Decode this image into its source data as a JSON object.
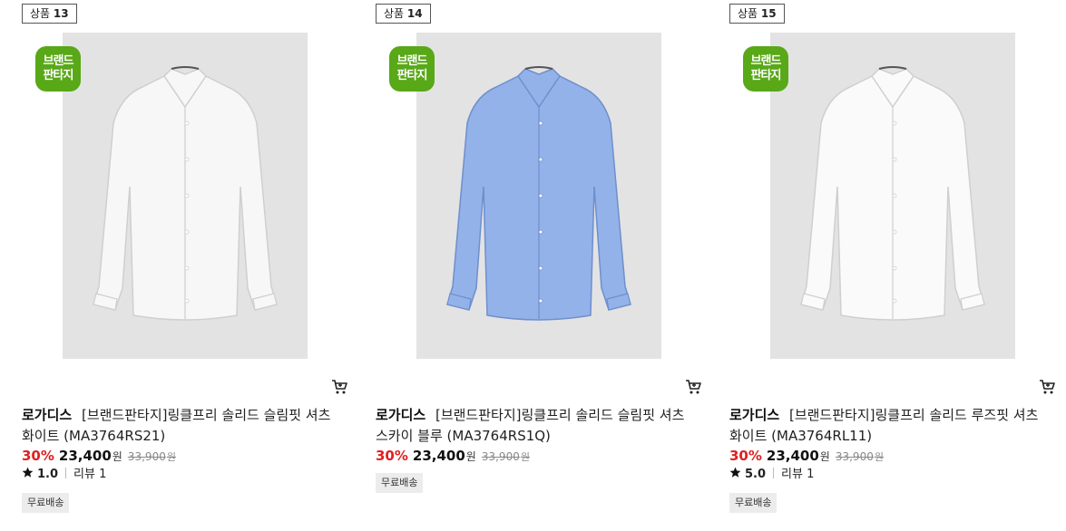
{
  "products": [
    {
      "tag_prefix": "상품",
      "tag_number": "13",
      "badge_line1": "브랜드",
      "badge_line2": "판타지",
      "brand": "로가디스",
      "name_line1": "[브랜드판타지]링클프리 솔리드 슬림핏 셔츠",
      "name_line2": "화이트 (MA3764RS21)",
      "discount": "30%",
      "price": "23,400",
      "currency": "원",
      "original_price": "33,900",
      "rating": "1.0",
      "review_label": "리뷰 1",
      "shipping": "무료배송",
      "shirt_color": "#f7f7f7"
    },
    {
      "tag_prefix": "상품",
      "tag_number": "14",
      "badge_line1": "브랜드",
      "badge_line2": "판타지",
      "brand": "로가디스",
      "name_line1": "[브랜드판타지]링클프리 솔리드 슬림핏 셔츠",
      "name_line2": "스카이 블루 (MA3764RS1Q)",
      "discount": "30%",
      "price": "23,400",
      "currency": "원",
      "original_price": "33,900",
      "shipping": "무료배송",
      "shirt_color": "#93b2ea"
    },
    {
      "tag_prefix": "상품",
      "tag_number": "15",
      "badge_line1": "브랜드",
      "badge_line2": "판타지",
      "brand": "로가디스",
      "name_line1": "[브랜드판타지]링클프리 솔리드 루즈핏 셔츠",
      "name_line2": "화이트 (MA3764RL11)",
      "discount": "30%",
      "price": "23,400",
      "currency": "원",
      "original_price": "33,900",
      "rating": "5.0",
      "review_label": "리뷰 1",
      "shipping": "무료배송",
      "shirt_color": "#fafafa"
    }
  ],
  "colors": {
    "discount": "#e02020",
    "badge": "#58a817",
    "image_bg": "#e3e3e3"
  },
  "icons": [
    "cart-icon",
    "star-icon"
  ]
}
